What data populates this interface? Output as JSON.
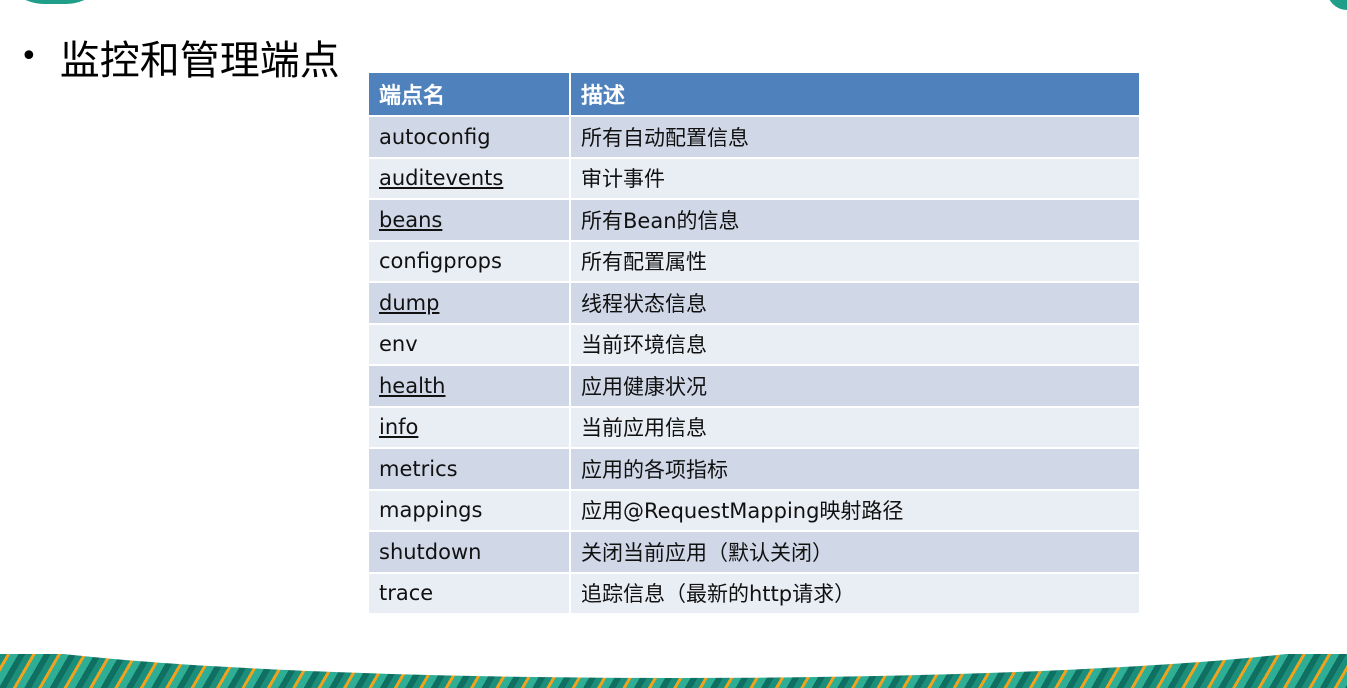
{
  "heading": {
    "bullet": "•",
    "text": "监控和管理端点"
  },
  "table": {
    "headers": [
      "端点名",
      "描述"
    ],
    "rows": [
      {
        "name": "autoconfig",
        "desc": "所有自动配置信息",
        "link": false
      },
      {
        "name": "auditevents",
        "desc": "审计事件",
        "link": true
      },
      {
        "name": "beans",
        "desc": "所有Bean的信息",
        "link": true
      },
      {
        "name": "configprops",
        "desc": "所有配置属性",
        "link": false
      },
      {
        "name": "dump",
        "desc": "线程状态信息",
        "link": true
      },
      {
        "name": "env",
        "desc": "当前环境信息",
        "link": false
      },
      {
        "name": "health",
        "desc": "应用健康状况",
        "link": true
      },
      {
        "name": "info",
        "desc": "当前应用信息",
        "link": true
      },
      {
        "name": "metrics",
        "desc": "应用的各项指标",
        "link": false
      },
      {
        "name": "mappings",
        "desc": "应用@RequestMapping映射路径",
        "link": false
      },
      {
        "name": "shutdown",
        "desc": "关闭当前应用（默认关闭）",
        "link": false
      },
      {
        "name": "trace",
        "desc": "追踪信息（最新的http请求）",
        "link": false
      }
    ]
  },
  "colors": {
    "header_bg": "#4f81bd",
    "row_odd": "#d0d8e8",
    "row_even": "#e9edf4",
    "accent_teal": "#1f9e8a",
    "accent_orange": "#f0a21d"
  }
}
